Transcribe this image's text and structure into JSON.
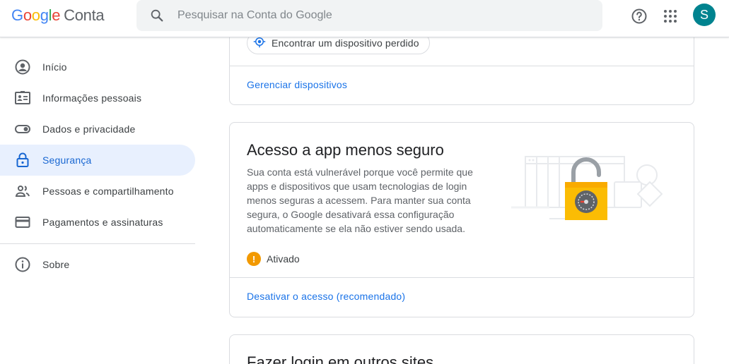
{
  "header": {
    "logo_letters": [
      "G",
      "o",
      "o",
      "g",
      "l",
      "e"
    ],
    "logo_suffix": "Conta",
    "search_placeholder": "Pesquisar na Conta do Google",
    "avatar_initial": "S"
  },
  "sidebar": {
    "items": [
      {
        "label": "Início",
        "icon": "account-circle-icon"
      },
      {
        "label": "Informações pessoais",
        "icon": "id-card-icon"
      },
      {
        "label": "Dados e privacidade",
        "icon": "toggle-icon"
      },
      {
        "label": "Segurança",
        "icon": "lock-icon",
        "active": true
      },
      {
        "label": "Pessoas e compartilhamento",
        "icon": "people-icon"
      },
      {
        "label": "Pagamentos e assinaturas",
        "icon": "credit-card-icon"
      },
      {
        "label": "Sobre",
        "icon": "info-icon"
      }
    ]
  },
  "devices_card": {
    "find_device_chip": "Encontrar um dispositivo perdido",
    "manage_link": "Gerenciar dispositivos"
  },
  "less_secure_card": {
    "title": "Acesso a app menos seguro",
    "description": "Sua conta está vulnerável porque você permite que apps e dispositivos que usam tecnologias de login menos seguras a acessem. Para manter sua conta segura, o Google desativará essa configuração automaticamente se ela não estiver sendo usada.",
    "status": "Ativado",
    "action_link": "Desativar o acesso (recomendado)"
  },
  "other_sites_card": {
    "title": "Fazer login em outros sites"
  },
  "colors": {
    "accent": "#1a73e8",
    "active_bg": "#e8f0fe",
    "warning": "#f29900",
    "avatar": "#00838f"
  }
}
